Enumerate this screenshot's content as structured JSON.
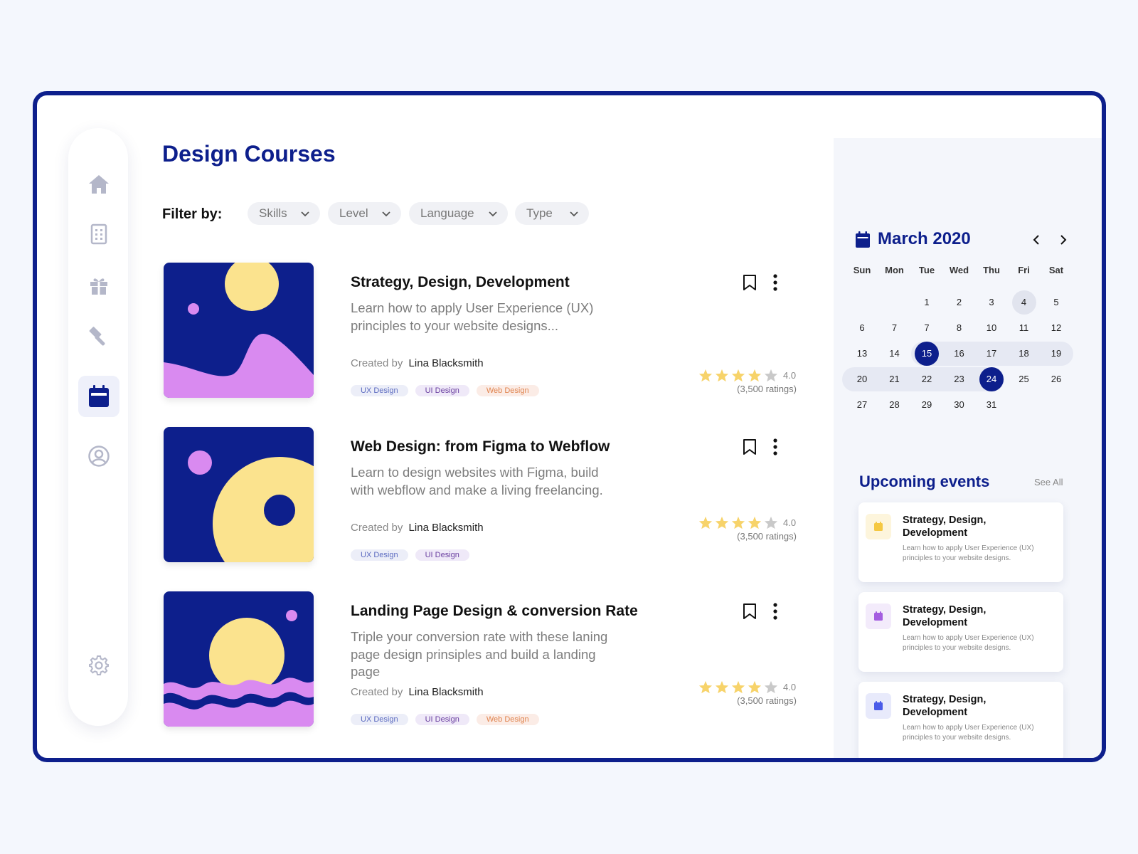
{
  "app": {
    "title": "Design Courses",
    "filter_label": "Filter by:"
  },
  "filters": [
    {
      "label": "Skills"
    },
    {
      "label": "Level"
    },
    {
      "label": "Language"
    },
    {
      "label": "Type"
    }
  ],
  "sidebar": {
    "items": [
      {
        "icon": "home-icon"
      },
      {
        "icon": "document-icon"
      },
      {
        "icon": "gift-icon"
      },
      {
        "icon": "hammer-icon"
      },
      {
        "icon": "calendar-icon",
        "active": true
      },
      {
        "icon": "user-icon"
      },
      {
        "icon": "gear-icon"
      }
    ]
  },
  "courses": [
    {
      "title": "Strategy, Design, Development",
      "description": "Learn how to apply User Experience (UX) principles to your website designs...",
      "creator_label": "Created by",
      "creator": "Lina Blacksmith",
      "tags": [
        "UX Design",
        "UI Design",
        "Web Design"
      ],
      "rating": "4.0",
      "stars": 4,
      "ratings_count": "(3,500 ratings)"
    },
    {
      "title": "Web Design: from Figma to Webflow",
      "description": "Learn to design websites with Figma, build with webflow and make a living freelancing.",
      "creator_label": "Created by",
      "creator": "Lina Blacksmith",
      "tags": [
        "UX Design",
        "UI Design"
      ],
      "rating": "4.0",
      "stars": 4,
      "ratings_count": "(3,500 ratings)"
    },
    {
      "title": "Landing Page Design & conversion Rate",
      "description": "Triple your conversion rate with these laning page design prinsiples and build a landing page",
      "creator_label": "Created by",
      "creator": "Lina Blacksmith",
      "tags": [
        "UX Design",
        "UI Design",
        "Web Design"
      ],
      "rating": "4.0",
      "stars": 4,
      "ratings_count": "(3,500 ratings)"
    }
  ],
  "calendar": {
    "title": "March 2020",
    "weekdays": [
      "Sun",
      "Mon",
      "Tue",
      "Wed",
      "Thu",
      "Fri",
      "Sat"
    ],
    "weeks": [
      [
        "",
        "",
        "1",
        "2",
        "3",
        "4",
        "5"
      ],
      [
        "6",
        "7",
        "7",
        "8",
        "10",
        "11",
        "12"
      ],
      [
        "13",
        "14",
        "15",
        "16",
        "17",
        "18",
        "19"
      ],
      [
        "20",
        "21",
        "22",
        "23",
        "24",
        "25",
        "26"
      ],
      [
        "27",
        "28",
        "29",
        "30",
        "31",
        "",
        ""
      ]
    ],
    "today": "4",
    "selected": [
      "15",
      "24"
    ]
  },
  "events": {
    "heading": "Upcoming events",
    "see_all": "See All",
    "items": [
      {
        "title": "Strategy, Design, Development",
        "description": "Learn how to apply User Experience (UX) principles to your website designs.",
        "icon_color": "#f5c842",
        "icon_bg": "#fdf5dc"
      },
      {
        "title": "Strategy, Design, Development",
        "description": "Learn how to apply User Experience (UX) principles to your website designs.",
        "icon_color": "#a45de0",
        "icon_bg": "#f3ebfb"
      },
      {
        "title": "Strategy, Design, Development",
        "description": "Learn how to apply User Experience (UX) principles to your website designs.",
        "icon_color": "#4a5be8",
        "icon_bg": "#e8eafb"
      }
    ]
  },
  "colors": {
    "brand": "#0d1f8c",
    "star": "#f7d36a",
    "star_empty": "#c9c9c9",
    "thumb_yellow": "#fbe38e",
    "thumb_pink": "#d98af0"
  }
}
